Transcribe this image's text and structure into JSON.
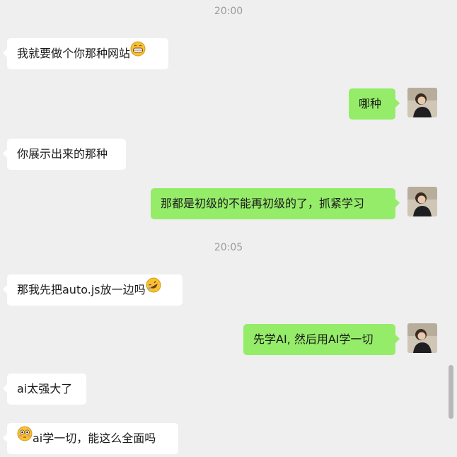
{
  "timestamps": [
    "20:00",
    "20:05"
  ],
  "messages": [
    {
      "side": "in",
      "text": "我就要做个你那种网站",
      "emoji": "grinning-face-emoji"
    },
    {
      "side": "out",
      "text": "哪种"
    },
    {
      "side": "in",
      "text": "你展示出来的那种"
    },
    {
      "side": "out",
      "text": "那都是初级的不能再初级的了，抓紧学习"
    },
    {
      "side": "in",
      "text": "那我先把auto.js放一边吗",
      "emoji": "rolling-laughing-face-emoji"
    },
    {
      "side": "out",
      "text": "先学AI, 然后用AI学一切"
    },
    {
      "side": "in",
      "text": "ai太强大了"
    },
    {
      "side": "in",
      "text": "ai学一切，能这么全面吗",
      "emoji_leading": "flushed-face-emoji"
    }
  ],
  "avatar": {
    "icon": "user-avatar-photo"
  },
  "colors": {
    "background": "#efefef",
    "incoming": "#ffffff",
    "outgoing": "#95ec69",
    "timestamp": "#9b9b9b"
  }
}
